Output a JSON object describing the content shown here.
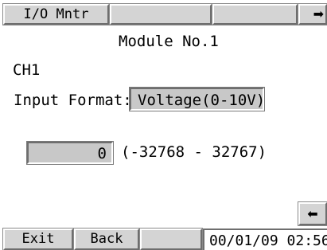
{
  "header": {
    "tabs": [
      {
        "label": "I/O Mntr"
      },
      {
        "label": ""
      },
      {
        "label": ""
      }
    ],
    "next_icon": "arrow-right-icon"
  },
  "main": {
    "module_title": "Module No.1",
    "channel": "CH1",
    "input_format_label": "Input Format:",
    "input_format_value": "Voltage(0-10V)",
    "current_value": "0",
    "range_text": "(-32768 - 32767)",
    "back_icon": "arrow-left-icon"
  },
  "footer": {
    "exit_label": "Exit",
    "back_label": "Back",
    "blank_label": "",
    "datetime": "00/01/09 02:56"
  },
  "colors": {
    "button_face": "#d4d4d4",
    "field_face": "#c8c8c8",
    "background": "#ffffff"
  }
}
